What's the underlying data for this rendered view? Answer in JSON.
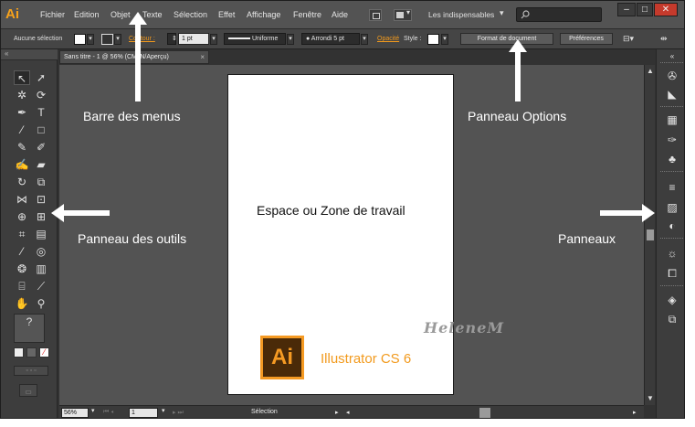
{
  "app": {
    "logo": "Ai",
    "menus": [
      "Fichier",
      "Edition",
      "Objet",
      "Texte",
      "Sélection",
      "Effet",
      "Affichage",
      "Fenêtre",
      "Aide"
    ],
    "workspace": "Les indispensables",
    "window_buttons": [
      "–",
      "□",
      "✕"
    ]
  },
  "options_bar": {
    "no_selection": "Aucune sélection",
    "stroke_label": "Contour :",
    "stroke_weight": "1 pt",
    "profile": "Uniforme",
    "brush": "Arrondi 5 pt",
    "opacity_label": "Opacité",
    "style_label": "Style :",
    "doc_setup_button": "Format de document",
    "preferences_button": "Préférences"
  },
  "document": {
    "tab_title": "Sans titre - 1 @ 56% (CMJN/Aperçu)",
    "close": "×"
  },
  "status_bar": {
    "zoom": "56%",
    "page": "1",
    "tool_status": "Sélection"
  },
  "annotations": {
    "menu_bar": "Barre des menus",
    "options_panel": "Panneau Options",
    "tools_panel": "Panneau des outils",
    "workspace": "Espace ou Zone de travail",
    "panels": "Panneaux",
    "product_badge": "Ai",
    "product_name": "Illustrator CS 6",
    "watermark": "HeleneM"
  },
  "colors": {
    "accent": "#f29a1d",
    "interface": "#323232",
    "canvas": "#535353"
  }
}
